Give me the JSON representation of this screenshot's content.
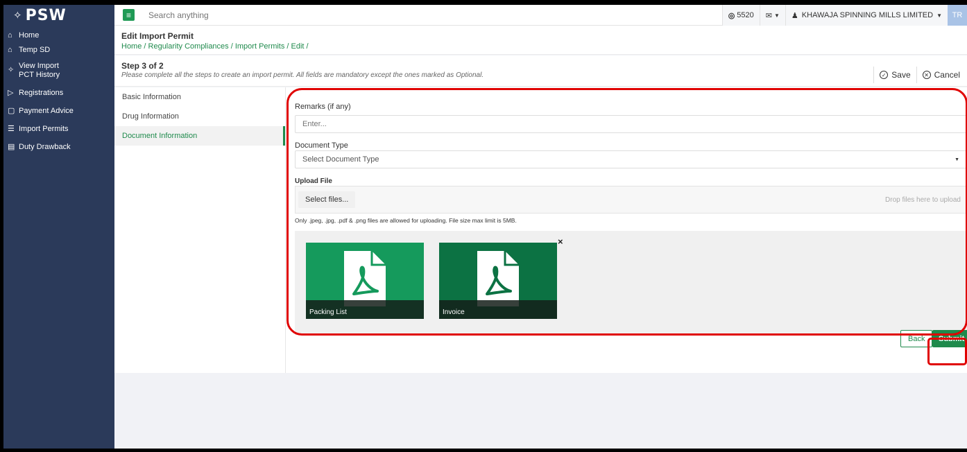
{
  "brand": {
    "logo_text": "PSW",
    "logo_glyph": "✧"
  },
  "sidebar": {
    "items": [
      {
        "icon": "home-icon",
        "glyph": "⌂",
        "label": "Home"
      },
      {
        "icon": "home-icon",
        "glyph": "⌂",
        "label": "Temp SD"
      },
      {
        "icon": "sparkle-icon",
        "glyph": "✧",
        "label": "View Import PCT History"
      },
      {
        "icon": "registration-icon",
        "glyph": "▷",
        "label": "Registrations"
      },
      {
        "icon": "payment-icon",
        "glyph": "▢",
        "label": "Payment Advice"
      },
      {
        "icon": "document-icon",
        "glyph": "☰",
        "label": "Import Permits"
      },
      {
        "icon": "drawback-icon",
        "glyph": "▤",
        "label": "Duty Drawback"
      }
    ]
  },
  "topbar": {
    "search_placeholder": "Search anything",
    "points": "5520",
    "company": "KHAWAJA SPINNING MILLS LIMITED",
    "avatar": "TR"
  },
  "page": {
    "title": "Edit Import Permit",
    "breadcrumb": "Home / Regularity Compliances / Import Permits / Edit /"
  },
  "step": {
    "title": "Step 3 of 2",
    "description": "Please complete all the steps to create an import permit. All fields are mandatory except the ones marked as Optional.",
    "save": "Save",
    "cancel": "Cancel"
  },
  "steps": [
    "Basic Information",
    "Drug Information",
    "Document Information"
  ],
  "form": {
    "remarks_label": "Remarks (if any)",
    "remarks_placeholder": "Enter...",
    "doc_type_label": "Document Type",
    "doc_type_placeholder": "Select Document Type",
    "upload_label": "Upload File",
    "select_files": "Select files...",
    "drop_hint": "Drop files here to upload",
    "file_hint": "Only .jpeg, .jpg, .pdf & .png files are allowed for uploading. File size max limit is 5MB.",
    "files": [
      "Packing List",
      "Invoice"
    ],
    "back": "Back",
    "submit": "Submit"
  },
  "colors": {
    "accent": "#1f8a4c",
    "sidebar": "#2b3a5a",
    "highlight": "#e00000"
  }
}
